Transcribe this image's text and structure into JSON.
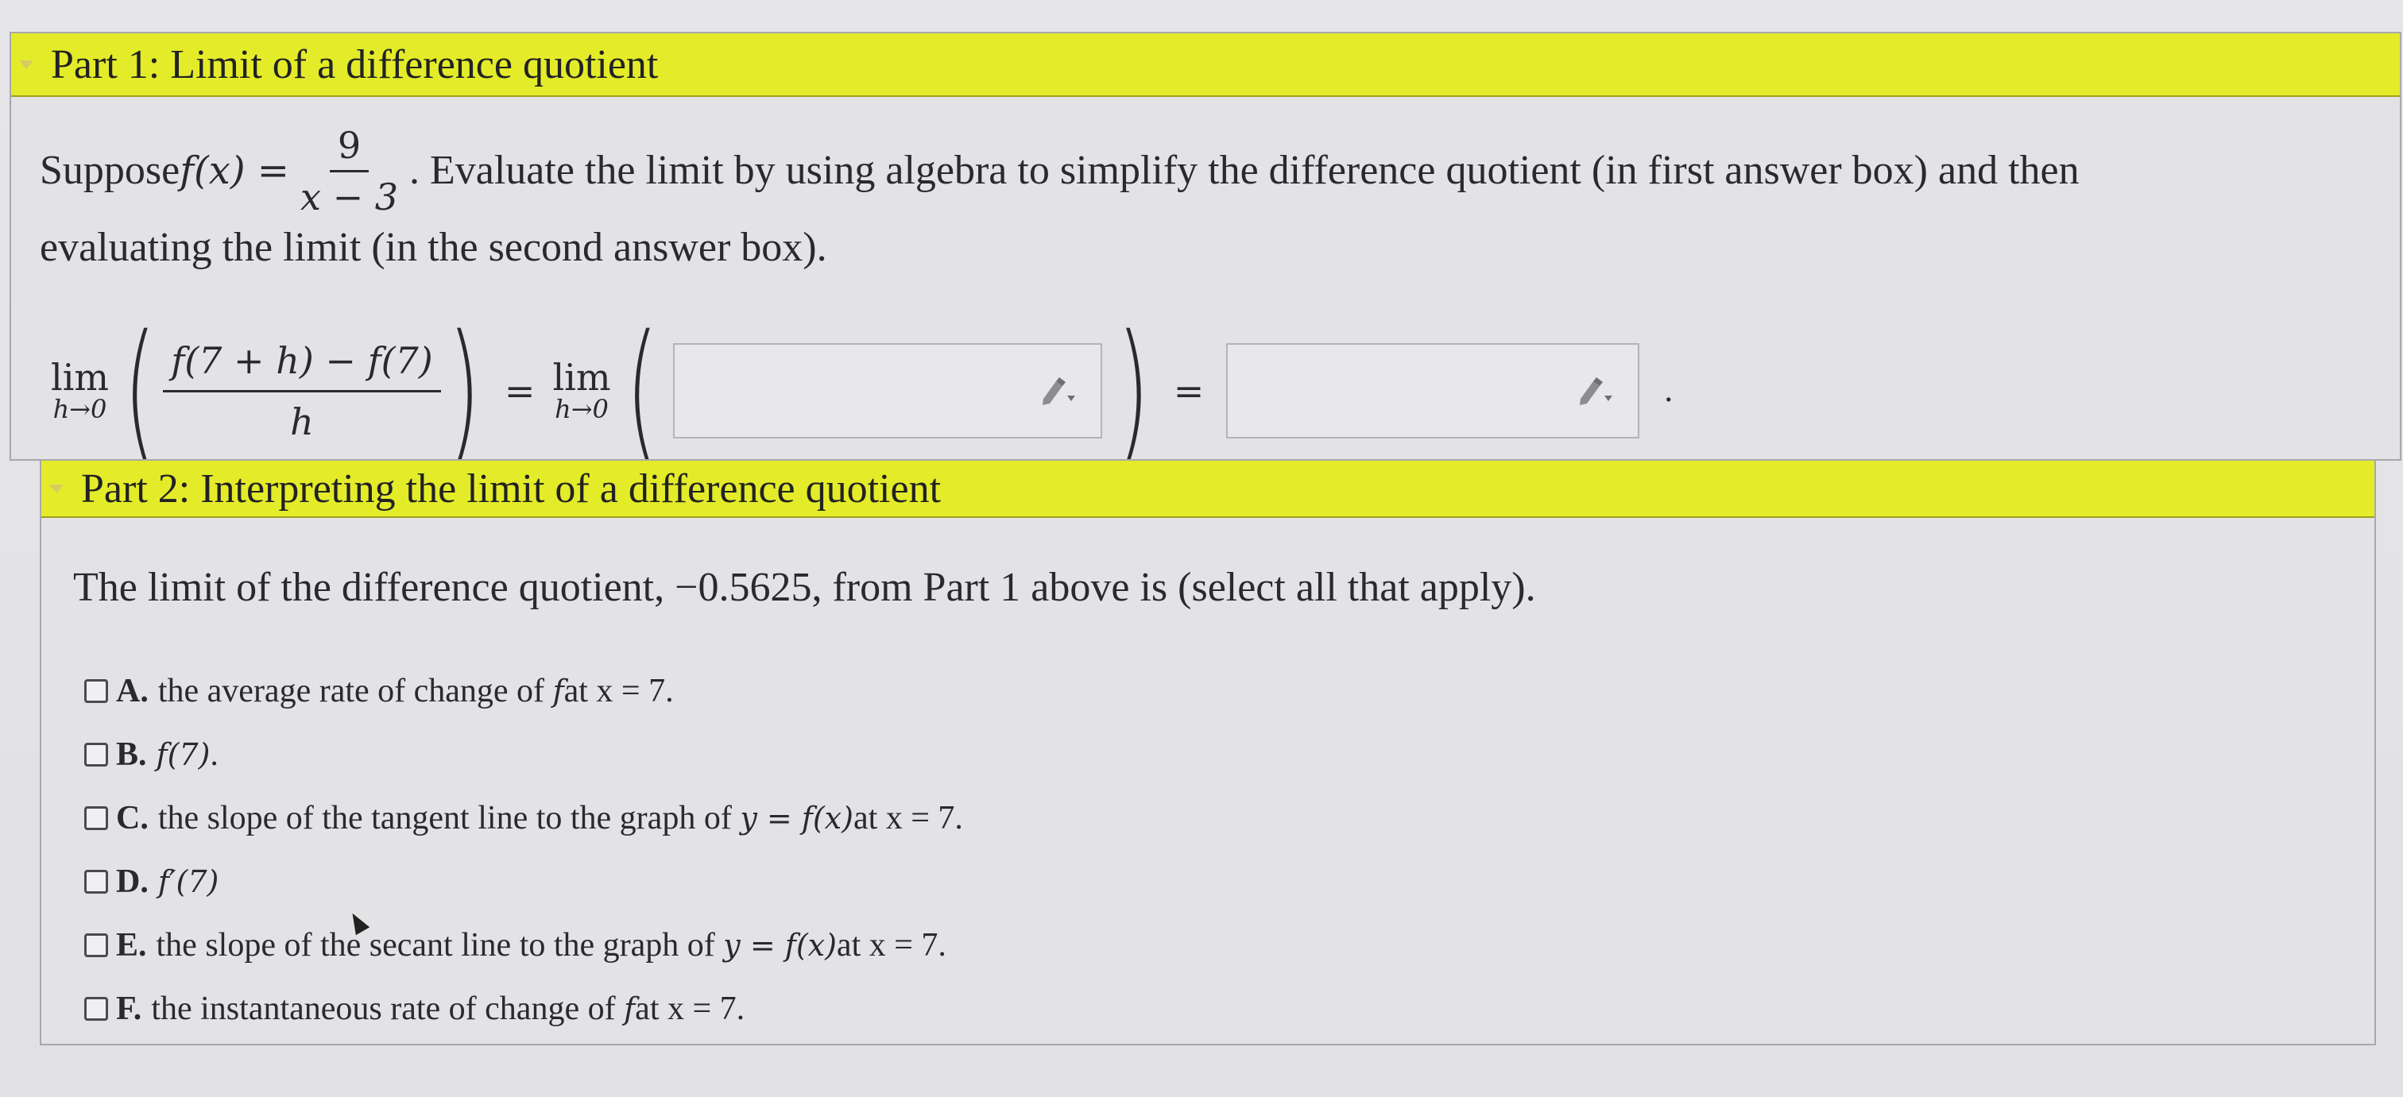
{
  "part1": {
    "title": "Part 1: Limit of a difference quotient",
    "text_before": "Suppose ",
    "func": "f(x) = ",
    "frac_num": "9",
    "frac_den": "x − 3",
    "text_after": ". Evaluate the limit by using algebra to simplify the difference quotient (in first answer box) and then",
    "text_line2": "evaluating the limit (in the second answer box).",
    "lim_word": "lim",
    "lim_sub": "h→0",
    "dq_num": "f(7 + h) − f(7)",
    "dq_den": "h",
    "equals": "=",
    "answer1_value": "",
    "answer2_value": "",
    "trailing": "."
  },
  "part2": {
    "title": "Part 2: Interpreting the limit of a difference quotient",
    "intro": "The limit of the difference quotient, −0.5625, from Part 1 above is (select all that apply).",
    "options": [
      {
        "letter": "A.",
        "text": "the average rate of change of ",
        "math": "f",
        "tail": " at x = 7."
      },
      {
        "letter": "B.",
        "text": "",
        "math": "f(7)",
        "tail": "."
      },
      {
        "letter": "C.",
        "text": "the slope of the tangent line to the graph of ",
        "math": "y = f(x)",
        "tail": " at x = 7."
      },
      {
        "letter": "D.",
        "text": "",
        "math": "f′(7)",
        "tail": ""
      },
      {
        "letter": "E.",
        "text": "the slope of the secant line to the graph of ",
        "math": "y = f(x)",
        "tail": " at x = 7."
      },
      {
        "letter": "F.",
        "text": "the instantaneous rate of change of ",
        "math": "f",
        "tail": " at x = 7."
      }
    ]
  },
  "colors": {
    "header_yellow": "#e4ec2a",
    "panel_bg": "#e3e3e5",
    "border": "#a8a8ac"
  },
  "icons": {
    "answer_tool": "pencil-dropdown-icon",
    "collapse": "triangle-down-icon"
  }
}
